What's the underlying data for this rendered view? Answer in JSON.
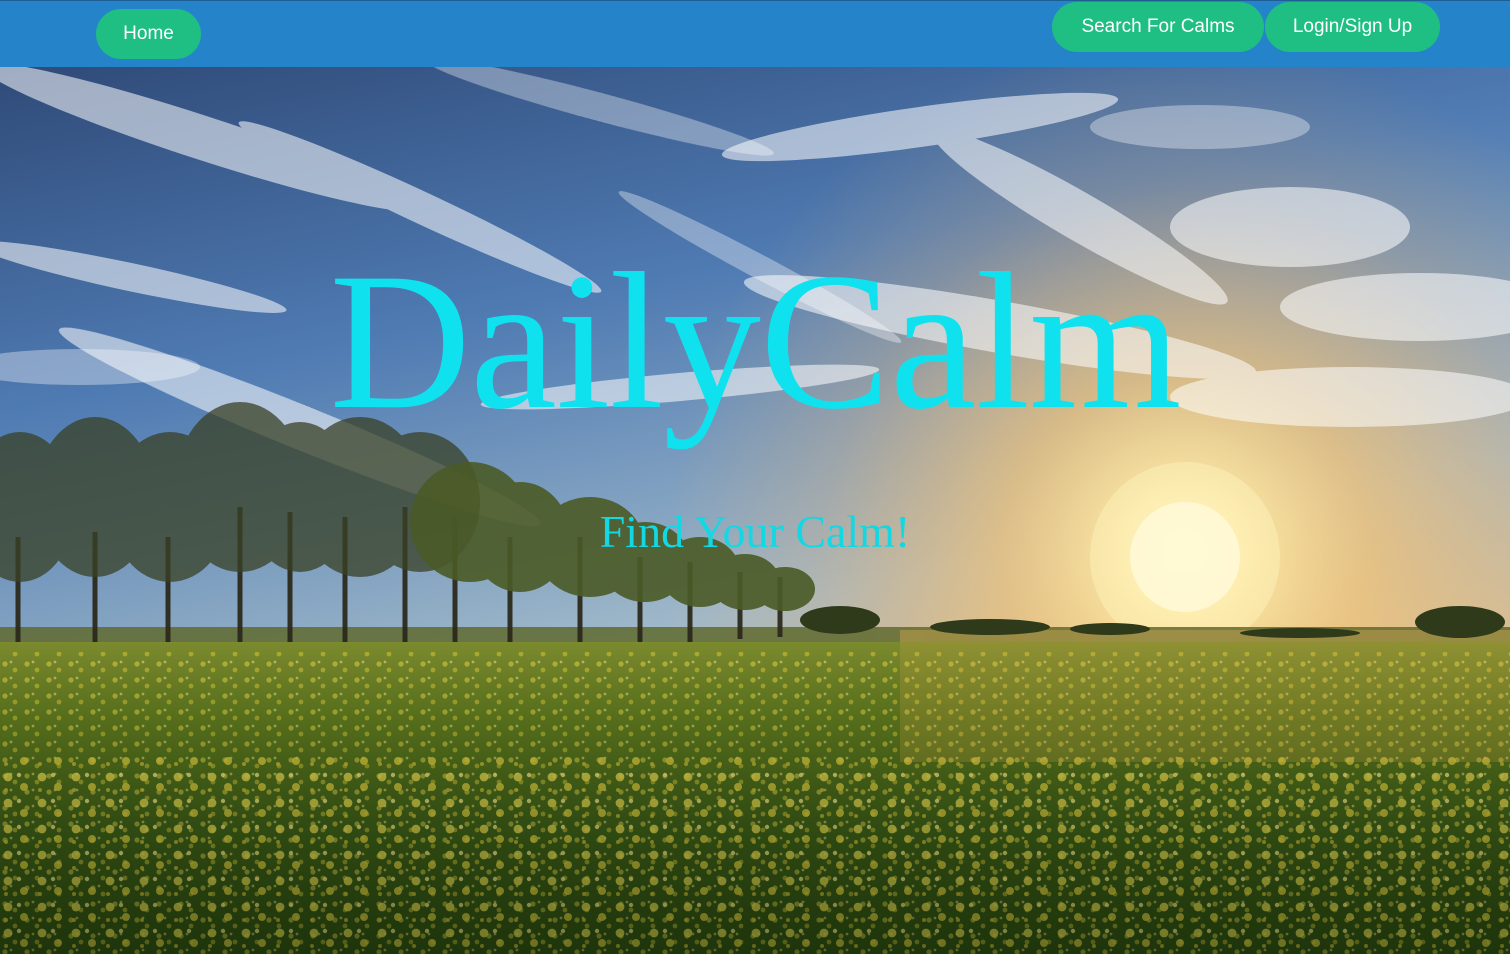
{
  "navbar": {
    "home_label": "Home",
    "search_label": "Search For Calms",
    "login_label": "Login/Sign Up",
    "background_color": "#2583c9",
    "button_color": "#1fbf83"
  },
  "hero": {
    "title": "DailyCalm",
    "subtitle": "Find Your Calm!",
    "text_color": "#0fe2ee",
    "background_image": "sunset-over-yellow-rapeseed-field"
  }
}
